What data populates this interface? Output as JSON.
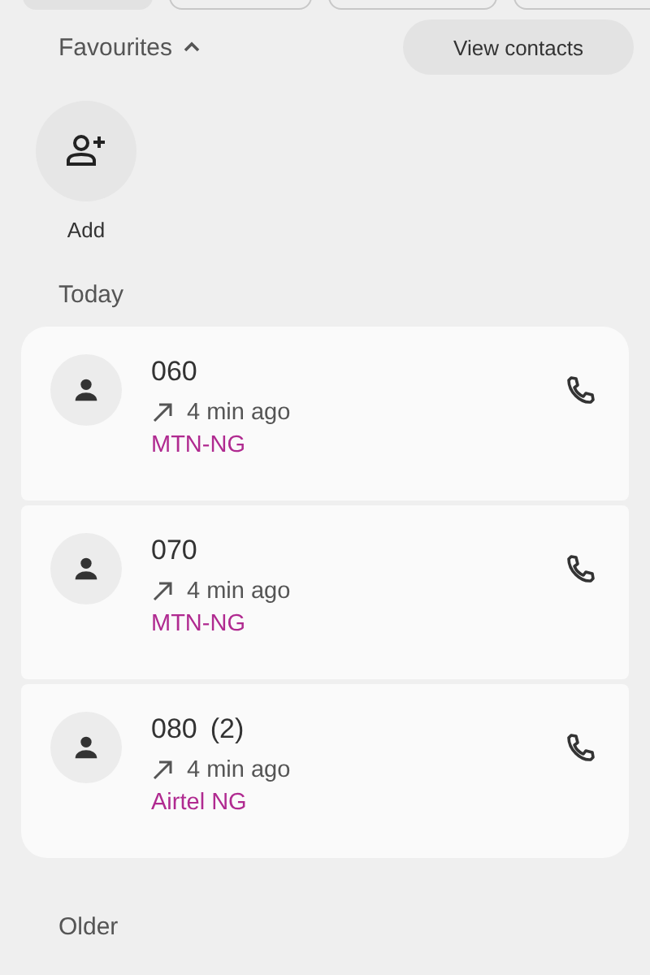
{
  "filter_chips": [
    {
      "selected": true
    },
    {
      "selected": false
    },
    {
      "selected": false
    },
    {
      "selected": false
    }
  ],
  "favourites": {
    "title": "Favourites",
    "expanded": true,
    "button": "View contacts",
    "add_label": "Add"
  },
  "sections": [
    {
      "title": "Today",
      "calls": [
        {
          "number": "060",
          "time": "4 min ago",
          "carrier": "MTN-NG"
        },
        {
          "number": "070",
          "time": "4 min ago",
          "carrier": "MTN-NG"
        },
        {
          "number": "080",
          "count": "(2)",
          "time": "4 min ago",
          "carrier": "Airtel NG"
        }
      ]
    },
    {
      "title": "Older"
    }
  ]
}
